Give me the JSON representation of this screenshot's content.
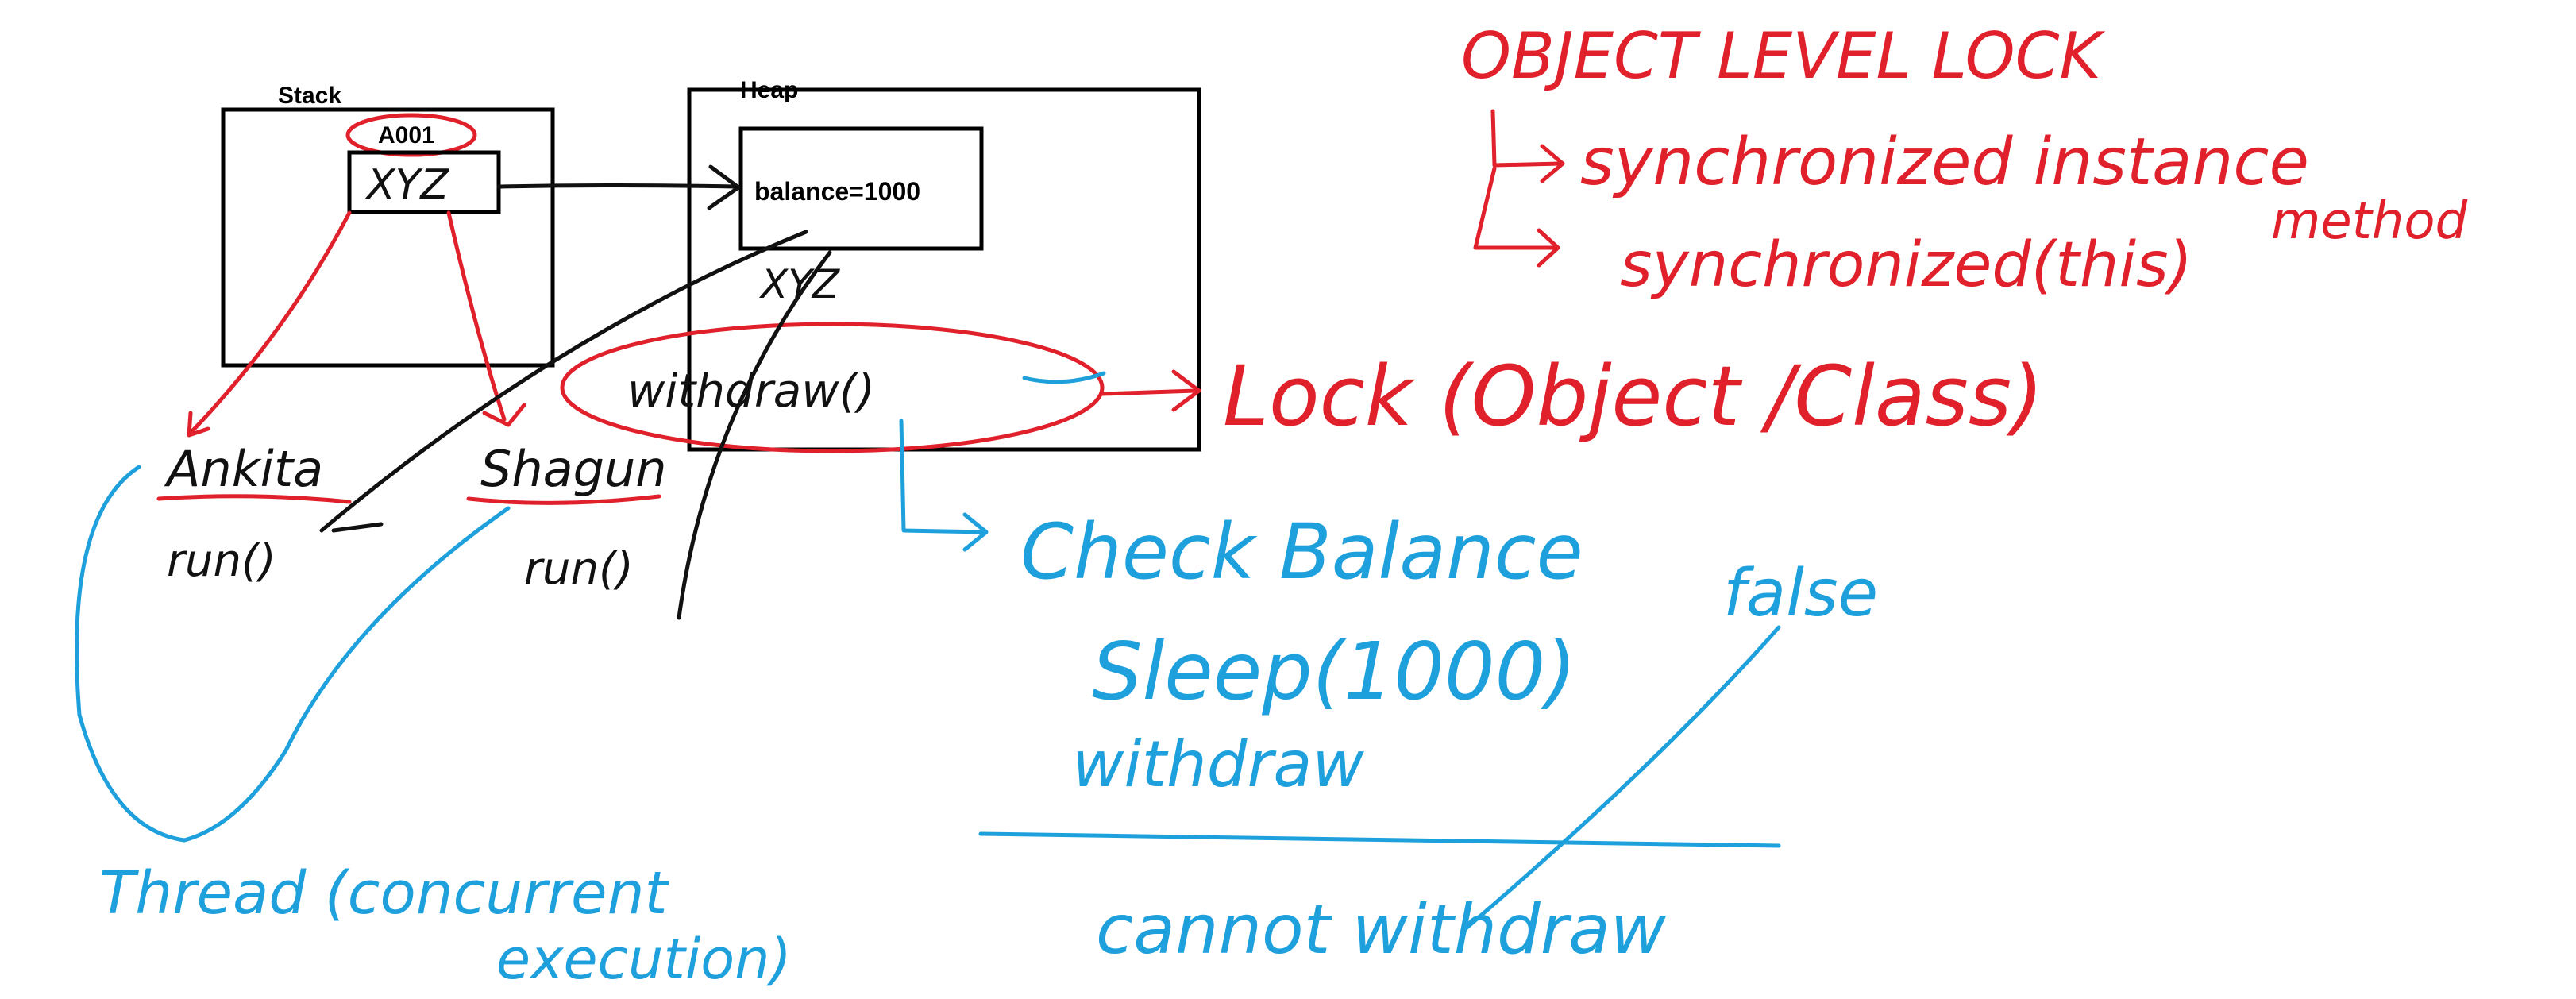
{
  "colors": {
    "red_ink": "#e0202a",
    "blue_ink": "#1ea0dc",
    "black_ink": "#111111"
  },
  "printed": {
    "stack_label": "Stack",
    "heap_label": "Heap",
    "ref_id": "A001",
    "heap_object": "balance=1000"
  },
  "handwriting": {
    "stack_ref": "XYZ",
    "heap_ref": "XYZ",
    "method": "withdraw()",
    "thread1_name": "Ankita",
    "thread2_name": "Shagun",
    "run1": "run()",
    "run2": "run()",
    "thread_note_line1": "Thread (concurrent",
    "thread_note_line2": "execution)",
    "title": "OBJECT LEVEL LOCK",
    "option1": "synchronized instance",
    "option1_suffix": "method",
    "option2": "synchronized(this)",
    "lock_text": "Lock (Object /Class)",
    "step1": "Check Balance",
    "step1_result": "false",
    "step2": "Sleep(1000)",
    "step3": "withdraw",
    "conclusion": "cannot withdraw"
  }
}
